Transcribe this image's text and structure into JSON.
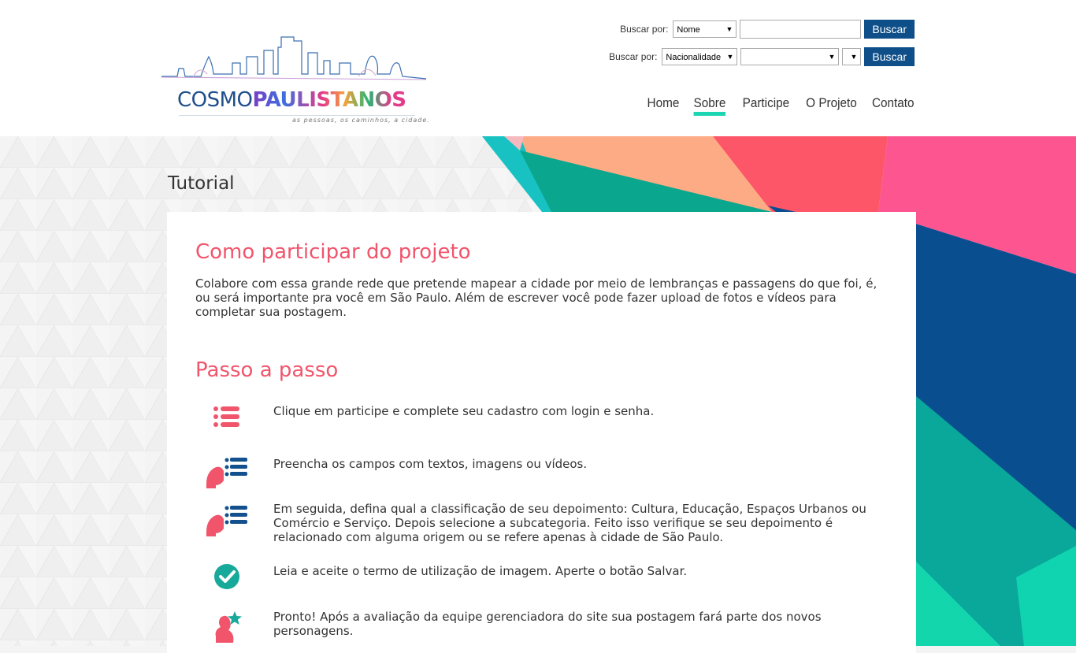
{
  "brand": {
    "name_part1": "COSMO",
    "name_part2": "PAULISTANOS",
    "tagline": "as pessoas, os caminhos, a cidade."
  },
  "search": {
    "row1": {
      "label": "Buscar por:",
      "select_value": "Nome",
      "input_value": "",
      "button": "Buscar"
    },
    "row2": {
      "label": "Buscar por:",
      "select_value": "Nacionalidade",
      "select2_value": "",
      "select3_value": "",
      "button": "Buscar"
    }
  },
  "nav": {
    "items": [
      {
        "label": "Home",
        "active": false
      },
      {
        "label": "Sobre",
        "active": true
      },
      {
        "label": "Participe",
        "active": false
      },
      {
        "label": "O Projeto",
        "active": false
      },
      {
        "label": "Contato",
        "active": false
      }
    ]
  },
  "page": {
    "title": "Tutorial"
  },
  "content": {
    "heading1": "Como participar do projeto",
    "intro": "Colabore com essa grande rede que pretende mapear a cidade por meio de lembranças e passagens do que foi, é, ou será importante pra você em São Paulo. Além de escrever você pode fazer upload de fotos e vídeos para completar sua postagem.",
    "heading2": "Passo a passo",
    "steps": [
      {
        "icon": "list-icon",
        "text": "Clique em participe e complete seu cadastro com login e senha."
      },
      {
        "icon": "profile-form-icon",
        "text": "Preencha os campos com textos, imagens ou vídeos."
      },
      {
        "icon": "profile-form-icon",
        "text": "Em seguida, defina qual a classificação de seu depoimento: Cultura, Educação, Espaços Urbanos ou Comércio e Serviço. Depois selecione a subcategoria. Feito isso verifique se seu depoimento é relacionado com alguma origem ou se refere apenas à cidade de São Paulo."
      },
      {
        "icon": "check-circle-icon",
        "text": "Leia e aceite o termo de utilização de imagem. Aperte o botão Salvar."
      },
      {
        "icon": "person-star-icon",
        "text": "Pronto! Após a avaliação da equipe gerenciadora do site sua postagem fará parte dos novos personagens."
      }
    ]
  },
  "colors": {
    "accent_pink": "#f0556c",
    "nav_underline": "#1bd5b3",
    "button_blue": "#0e4f8a",
    "icon_blue": "#13508e",
    "icon_teal": "#17a99a"
  }
}
